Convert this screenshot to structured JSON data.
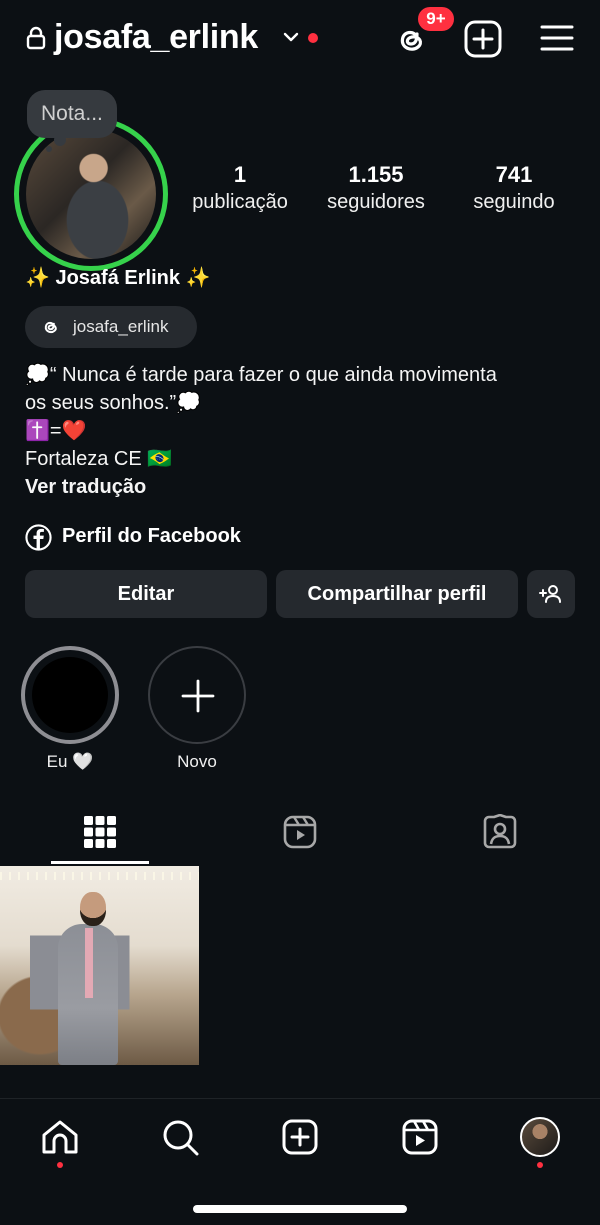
{
  "header": {
    "username": "josafa_erlink",
    "threads_badge": "9+",
    "icons": [
      "lock-icon",
      "chevron-down-icon",
      "threads-icon",
      "add-post-icon",
      "menu-icon"
    ],
    "notification_dot_color": "#ff3040"
  },
  "profile": {
    "note_bubble": "Nota...",
    "story_ring_color": "#36d24b",
    "stats": {
      "posts": {
        "value": "1",
        "label": "publicação"
      },
      "followers": {
        "value": "1.155",
        "label": "seguidores"
      },
      "following": {
        "value": "741",
        "label": "seguindo"
      }
    },
    "full_name": "✨ Josafá Erlink ✨",
    "threads_handle": "josafa_erlink",
    "bio_lines": [
      "💭“ Nunca é tarde para fazer o que ainda movimenta",
      "os seus sonhos.”💭",
      "✝️=❤️",
      "Fortaleza CE 🇧🇷"
    ],
    "translate_link": "Ver tradução",
    "facebook_link": "Perfil do Facebook"
  },
  "actions": {
    "edit": "Editar",
    "share": "Compartilhar perfil"
  },
  "highlights": [
    {
      "label": "Eu 🤍"
    },
    {
      "label": "Novo"
    }
  ],
  "tabs": [
    "grid-icon",
    "reels-icon",
    "tagged-icon"
  ],
  "bottom_nav": [
    "home-icon",
    "search-icon",
    "create-icon",
    "reels-icon",
    "profile-avatar"
  ]
}
